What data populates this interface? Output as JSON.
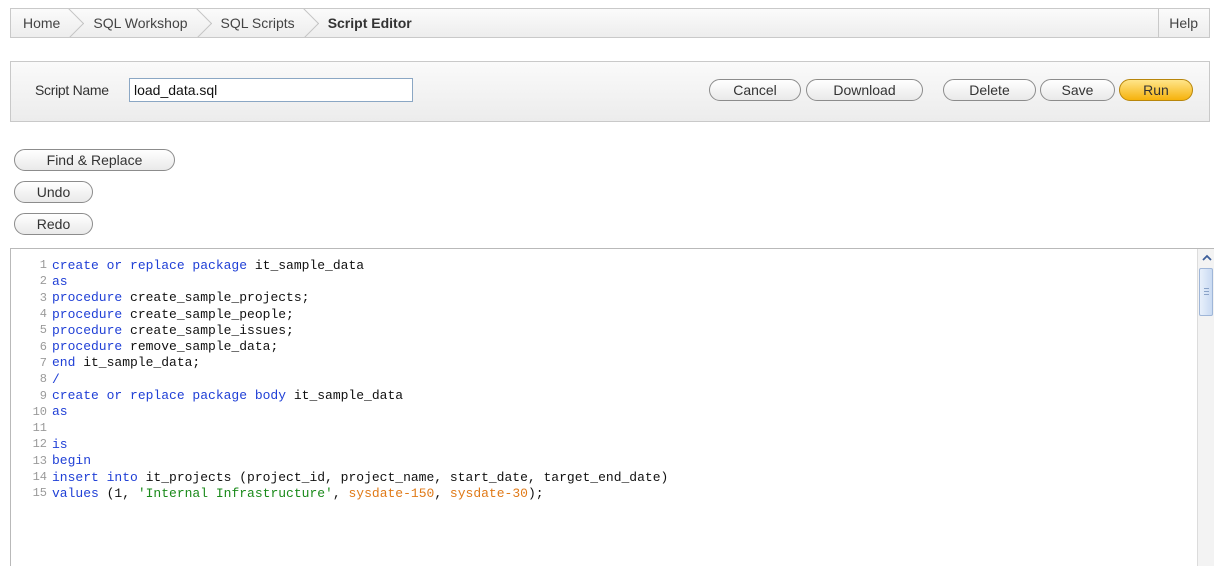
{
  "breadcrumb": {
    "items": [
      "Home",
      "SQL Workshop",
      "SQL Scripts"
    ],
    "current": "Script Editor",
    "help": "Help"
  },
  "script": {
    "label": "Script Name",
    "value": "load_data.sql"
  },
  "toolbar": {
    "cancel": "Cancel",
    "download": "Download",
    "delete": "Delete",
    "save": "Save",
    "run": "Run"
  },
  "editor_tools": {
    "find_replace": "Find & Replace",
    "undo": "Undo",
    "redo": "Redo"
  },
  "code": [
    {
      "n": "1",
      "tokens": [
        {
          "t": "create or replace package",
          "c": "kw"
        },
        {
          "t": " it_sample_data",
          "c": "plain"
        }
      ]
    },
    {
      "n": "2",
      "tokens": [
        {
          "t": "as",
          "c": "kw"
        }
      ]
    },
    {
      "n": "3",
      "tokens": [
        {
          "t": "procedure",
          "c": "kw"
        },
        {
          "t": " create_sample_projects;",
          "c": "plain"
        }
      ]
    },
    {
      "n": "4",
      "tokens": [
        {
          "t": "procedure",
          "c": "kw"
        },
        {
          "t": " create_sample_people;",
          "c": "plain"
        }
      ]
    },
    {
      "n": "5",
      "tokens": [
        {
          "t": "procedure",
          "c": "kw"
        },
        {
          "t": " create_sample_issues;",
          "c": "plain"
        }
      ]
    },
    {
      "n": "6",
      "tokens": [
        {
          "t": "procedure",
          "c": "kw"
        },
        {
          "t": " remove_sample_data;",
          "c": "plain"
        }
      ]
    },
    {
      "n": "7",
      "tokens": [
        {
          "t": "end",
          "c": "kw"
        },
        {
          "t": " it_sample_data;",
          "c": "plain"
        }
      ]
    },
    {
      "n": "8",
      "tokens": [
        {
          "t": "/",
          "c": "kw"
        }
      ]
    },
    {
      "n": "9",
      "tokens": [
        {
          "t": "create or replace package body",
          "c": "kw"
        },
        {
          "t": " it_sample_data",
          "c": "plain"
        }
      ]
    },
    {
      "n": "10",
      "tokens": [
        {
          "t": "as",
          "c": "kw"
        }
      ]
    },
    {
      "n": "11",
      "tokens": []
    },
    {
      "n": "12",
      "tokens": [
        {
          "t": "is",
          "c": "kw"
        }
      ]
    },
    {
      "n": "13",
      "tokens": [
        {
          "t": "begin",
          "c": "kw"
        }
      ]
    },
    {
      "n": "14",
      "tokens": [
        {
          "t": "insert into",
          "c": "kw"
        },
        {
          "t": " it_projects (project_id, project_name, start_date, target_end_date)",
          "c": "plain"
        }
      ]
    },
    {
      "n": "15",
      "tokens": [
        {
          "t": "values",
          "c": "kw"
        },
        {
          "t": " (1, ",
          "c": "plain"
        },
        {
          "t": "'Internal Infrastructure'",
          "c": "str"
        },
        {
          "t": ", ",
          "c": "plain"
        },
        {
          "t": "sysdate-150",
          "c": "fn"
        },
        {
          "t": ", ",
          "c": "plain"
        },
        {
          "t": "sysdate-30",
          "c": "fn"
        },
        {
          "t": ");",
          "c": "plain"
        }
      ]
    }
  ],
  "icons": {
    "scroll_up": "chevron-up-icon"
  },
  "colors": {
    "keyword": "#1f3fd6",
    "string": "#1a8a1a",
    "function": "#e07a18",
    "run_button": "#f6b20c"
  }
}
